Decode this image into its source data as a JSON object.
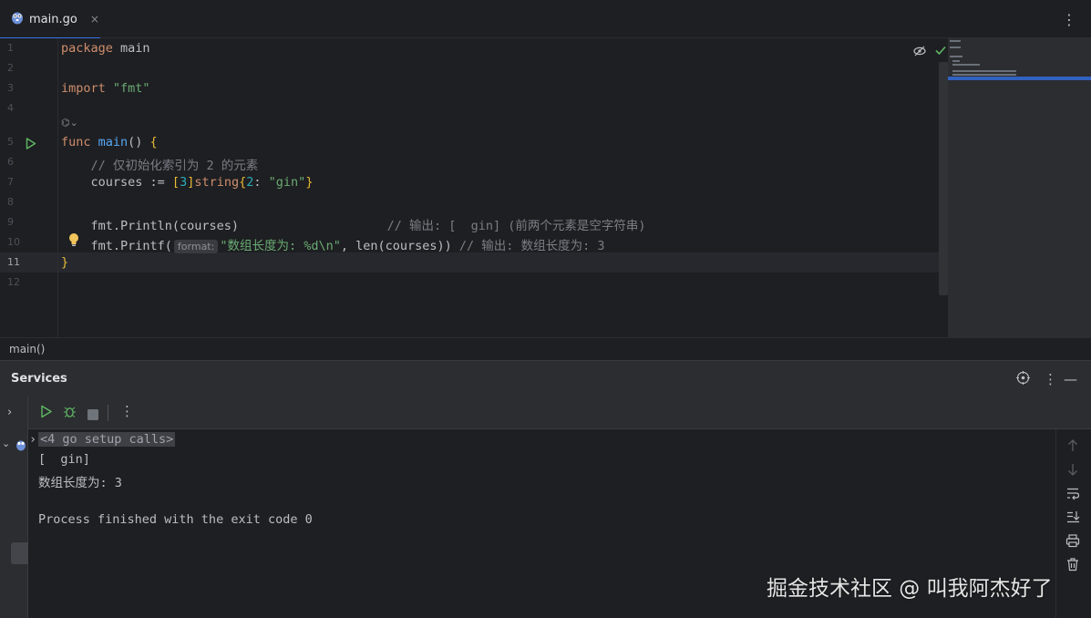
{
  "tab": {
    "filename": "main.go",
    "close": "×"
  },
  "editor": {
    "line_numbers": [
      "1",
      "2",
      "3",
      "4",
      "5",
      "6",
      "7",
      "8",
      "9",
      "10",
      "11",
      "12"
    ],
    "current_line": "11",
    "l1_kw": "package",
    "l1_name": " main",
    "l3_kw": "import",
    "l3_str": " \"fmt\"",
    "l4_hint": "⌬⌄",
    "l5_kw": "func",
    "l5_fn": " main",
    "l5_paren": "()",
    "l5_brace": " {",
    "l6_comment": "    // 仅初始化索引为 2 的元素",
    "l7_pre": "    courses := ",
    "l7_b1": "[",
    "l7_num": "3",
    "l7_b2": "]",
    "l7_type": "string",
    "l7_b3": "{",
    "l7_key": "2",
    "l7_colon": ": ",
    "l7_str": "\"gin\"",
    "l7_b4": "}",
    "l9_code": "    fmt.Println(courses)",
    "l9_comment": "                    // 输出: [  gin] (前两个元素是空字符串)",
    "l10_code": "    fmt.Printf(",
    "l10_hint": "format:",
    "l10_str": "\"数组长度为: %d\\n\"",
    "l10_rest": ", len(courses))",
    "l10_comment": " // 输出: 数组长度为: 3",
    "l11_brace": "}"
  },
  "breadcrumb": {
    "label": "main()"
  },
  "services": {
    "title": "Services",
    "console_lines": {
      "setup": "<4 go setup calls>",
      "out1": "[  gin]",
      "out2": "数组长度为: 3",
      "out3": "Process finished with the exit code 0"
    }
  },
  "watermark": "掘金技术社区 @ 叫我阿杰好了",
  "colors": {
    "background": "#1e1f22",
    "panel": "#2b2d30",
    "accent": "#3574f0",
    "run_green": "#5fb865",
    "keyword": "#cf8e6d",
    "string": "#6aab73",
    "function": "#56a8f5",
    "number": "#2aacb8",
    "comment": "#7a7e85"
  },
  "icons": [
    "go-file-icon",
    "close-icon",
    "more-vertical-icon",
    "run-gutter-icon",
    "inlay-hint-icon",
    "bulb-icon",
    "eye-crossed-icon",
    "check-icon",
    "target-icon",
    "minimize-icon",
    "expand-icon",
    "chevron-down-icon",
    "run-icon",
    "debug-icon",
    "stop-icon",
    "arrow-up-icon",
    "arrow-down-icon",
    "soft-wrap-icon",
    "scroll-end-icon",
    "print-icon",
    "trash-icon"
  ]
}
